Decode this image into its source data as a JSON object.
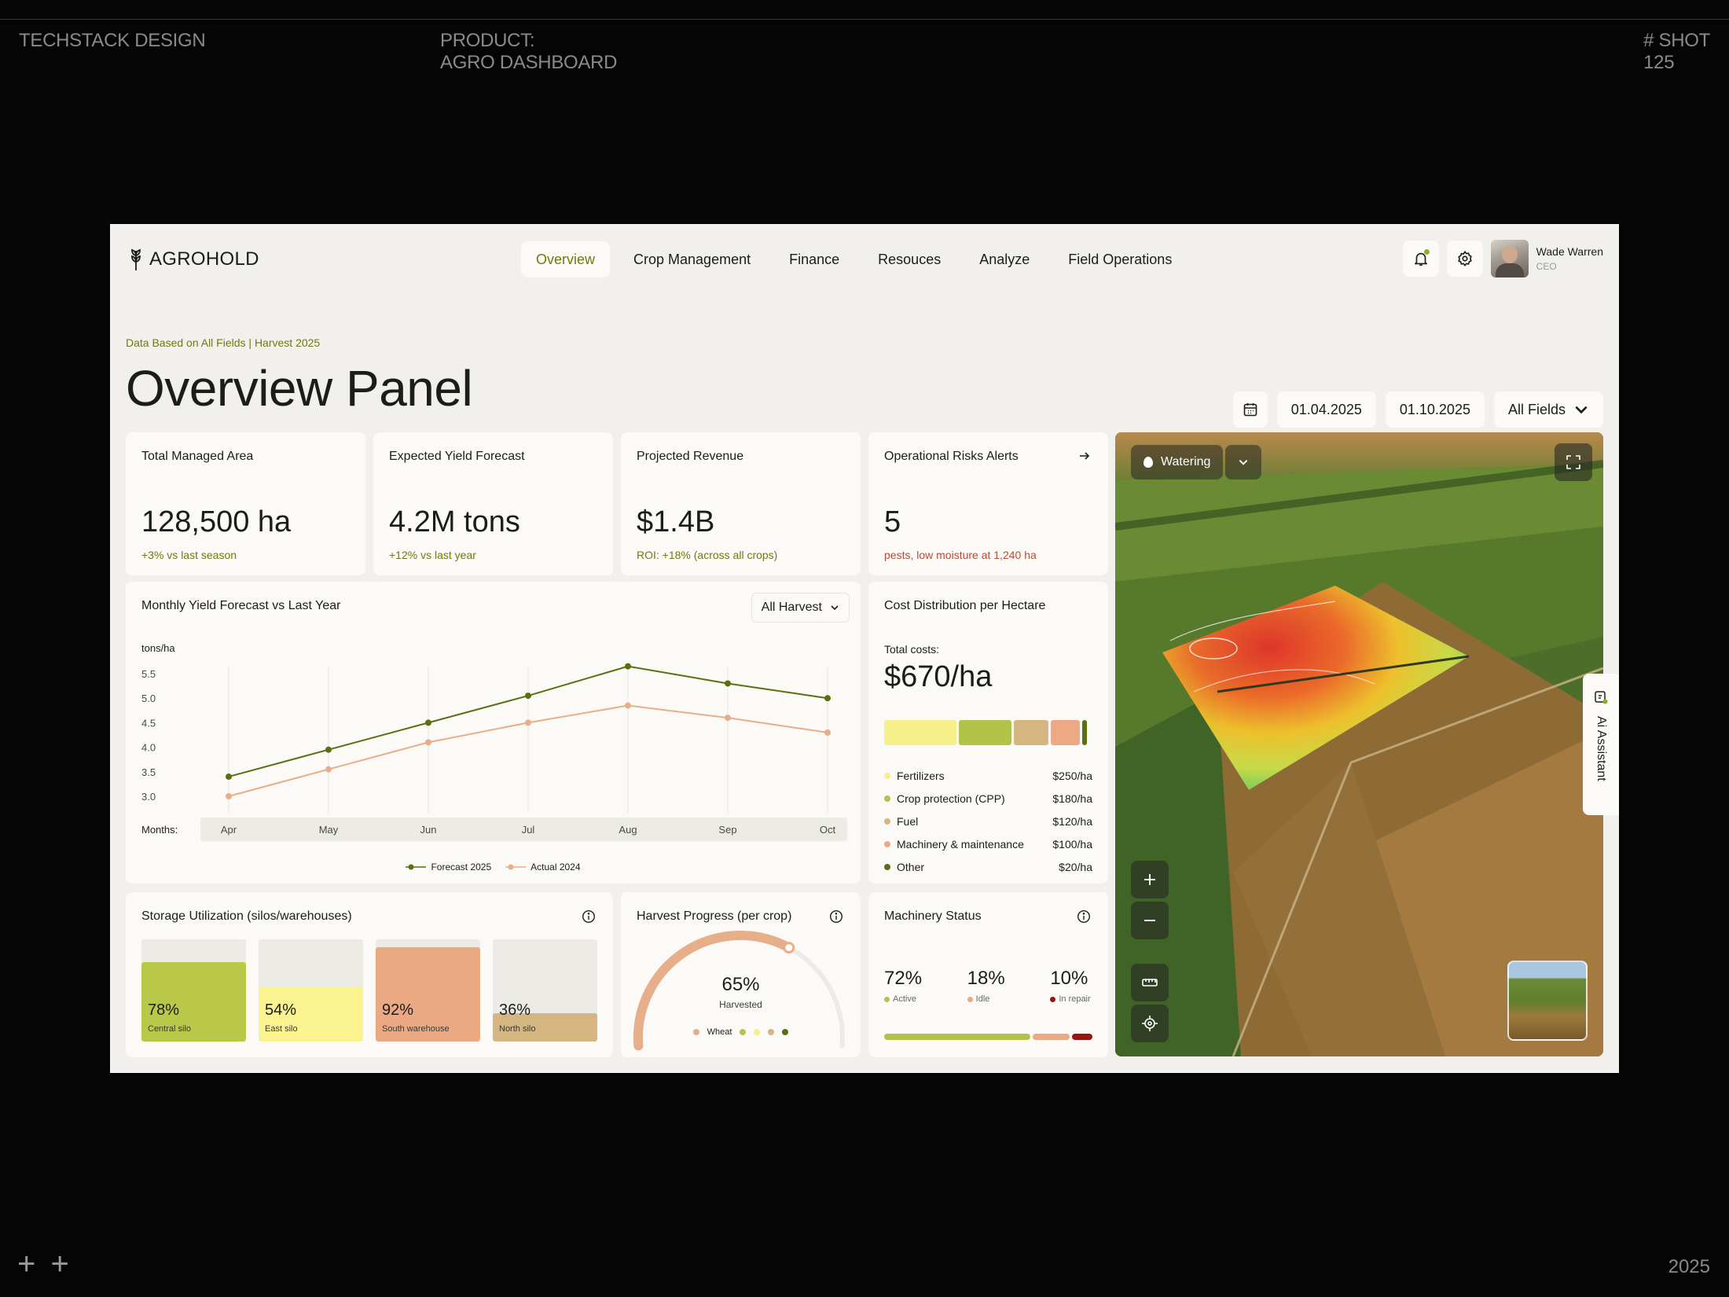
{
  "frame": {
    "brand": "TECHSTACK DESIGN",
    "product_line1": "PRODUCT:",
    "product_line2": "AGRO DASHBOARD",
    "shot_line1": "# SHOT",
    "shot_line2": "125",
    "year": "2025",
    "plus": "+ +"
  },
  "nav": {
    "logo": "AGROHOLD",
    "tabs": [
      {
        "label": "Overview",
        "active": true
      },
      {
        "label": "Crop Management"
      },
      {
        "label": "Finance"
      },
      {
        "label": "Resouces"
      },
      {
        "label": "Analyze"
      },
      {
        "label": "Field Operations"
      }
    ],
    "user": {
      "name": "Wade Warren",
      "role": "CEO"
    }
  },
  "header": {
    "subtitle": "Data Based on All Fields | Harvest 2025",
    "title": "Overview Panel",
    "date_from": "01.04.2025",
    "date_to": "01.10.2025",
    "field_filter": "All Fields"
  },
  "kpis": [
    {
      "title": "Total Managed Area",
      "value": "128,500 ha",
      "note": "+3% vs last season"
    },
    {
      "title": "Expected Yield Forecast",
      "value": "4.2M tons",
      "note": "+12% vs last year"
    },
    {
      "title": "Projected Revenue",
      "value": "$1.4B",
      "note": "ROI: +18% (across all crops)"
    },
    {
      "title": "Operational Risks Alerts",
      "value": "5",
      "note": "pests, low moisture at 1,240 ha"
    }
  ],
  "yield_chart": {
    "title": "Monthly Yield Forecast vs Last Year",
    "dropdown": "All Harvest",
    "months_label": "Months:"
  },
  "chart_data": {
    "type": "line",
    "title": "Monthly Yield Forecast vs Last Year",
    "ylabel": "tons/ha",
    "xlabel": "Months:",
    "categories": [
      "Apr",
      "May",
      "Jun",
      "Jul",
      "Aug",
      "Sep",
      "Oct"
    ],
    "yticks": [
      "5.5",
      "5.0",
      "4.5",
      "4.0",
      "3.5",
      "3.0"
    ],
    "ylim": [
      3.0,
      5.5
    ],
    "series": [
      {
        "name": "Forecast 2025",
        "color": "#5d6e12",
        "values": [
          3.4,
          3.95,
          4.5,
          5.05,
          5.65,
          5.3,
          5.0
        ]
      },
      {
        "name": "Actual 2024",
        "color": "#e7ae8a",
        "values": [
          3.0,
          3.55,
          4.1,
          4.5,
          4.85,
          4.6,
          4.3
        ]
      }
    ],
    "grid": true,
    "legend": "bottom-center"
  },
  "costs": {
    "title": "Cost Distribution per Hectare",
    "total_label": "Total costs:",
    "total_value": "$670/ha",
    "items": [
      {
        "name": "Fertilizers",
        "value": "$250/ha",
        "color": "#f6f08a",
        "share": 250
      },
      {
        "name": "Crop protection (CPP)",
        "value": "$180/ha",
        "color": "#b2c34a",
        "share": 180
      },
      {
        "name": "Fuel",
        "value": "$120/ha",
        "color": "#d5b683",
        "share": 120
      },
      {
        "name": "Machinery & maintenance",
        "value": "$100/ha",
        "color": "#eca983",
        "share": 100
      },
      {
        "name": "Other",
        "value": "$20/ha",
        "color": "#5d6e12",
        "share": 20
      }
    ]
  },
  "storage": {
    "title": "Storage Utilization (silos/warehouses)",
    "silos": [
      {
        "pct": "78%",
        "name": "Central silo",
        "level": 0.78,
        "color": "#b9c848"
      },
      {
        "pct": "54%",
        "name": "East silo",
        "level": 0.54,
        "color": "#fbf38f"
      },
      {
        "pct": "92%",
        "name": "South warehouse",
        "level": 0.92,
        "color": "#eba983"
      },
      {
        "pct": "36%",
        "name": "North silo",
        "level": 0.28,
        "color": "#d5b683"
      }
    ]
  },
  "harvest": {
    "title": "Harvest Progress (per crop)",
    "pct": "65%",
    "label": "Harvested",
    "level": 0.65,
    "crop": "Wheat",
    "crop_dots": [
      "#e7ae8a",
      "#b2c34a",
      "#f6f08a",
      "#d5b683",
      "#5d6e12"
    ]
  },
  "machinery": {
    "title": "Machinery Status",
    "stats": [
      {
        "pct": "72%",
        "label": "Active",
        "color": "#b2c34a",
        "share": 72
      },
      {
        "pct": "18%",
        "label": "Idle",
        "color": "#eca983",
        "share": 18
      },
      {
        "pct": "10%",
        "label": "In repair",
        "color": "#9a1414",
        "share": 10
      }
    ]
  },
  "map": {
    "layer": "Watering"
  },
  "ai": {
    "label": "Ai Assistant"
  }
}
